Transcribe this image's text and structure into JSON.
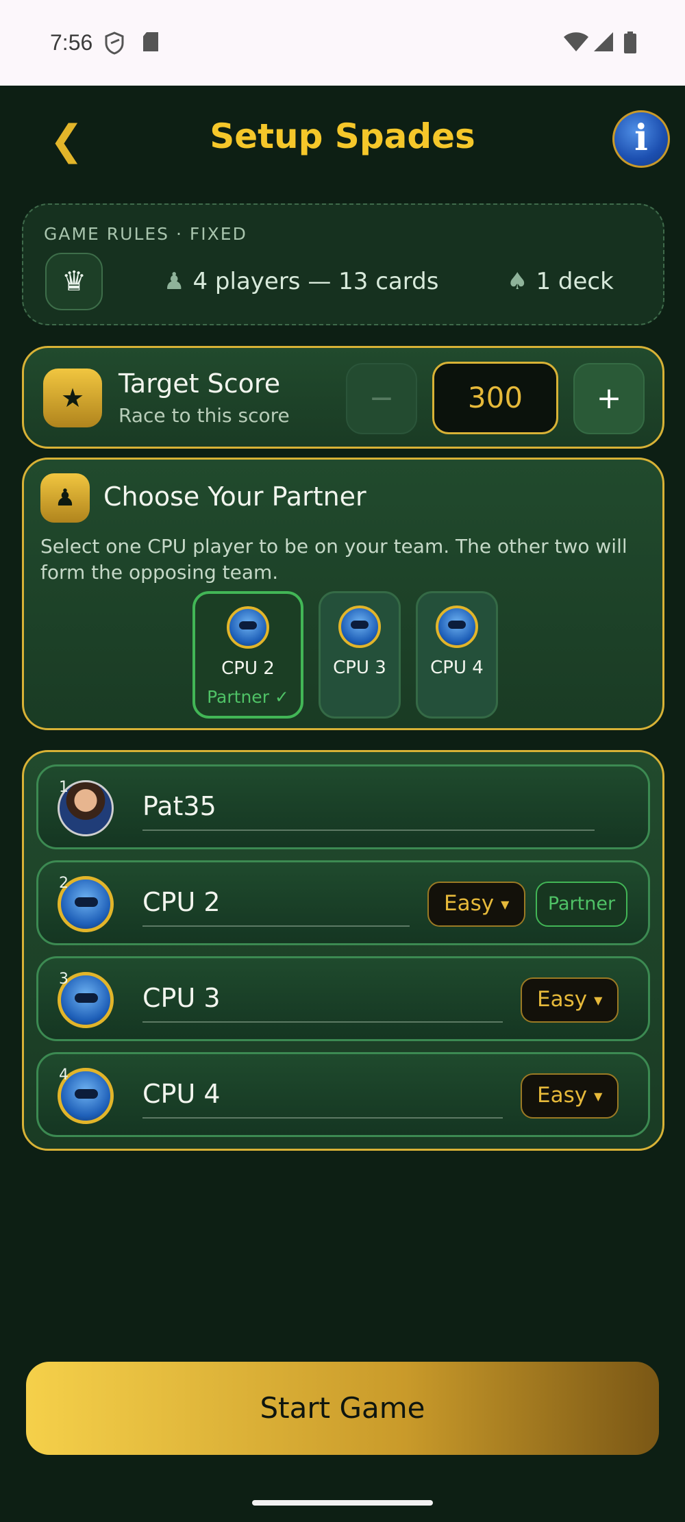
{
  "status_bar": {
    "time": "7:56"
  },
  "header": {
    "title": "Setup Spades",
    "back_glyph": "❮",
    "info_glyph": "i"
  },
  "rules": {
    "title": "GAME RULES · FIXED",
    "players": "4 players — 13 cards",
    "deck": "1 deck"
  },
  "target": {
    "title": "Target Score",
    "subtitle": "Race to this score",
    "value": "300",
    "minus": "−",
    "plus": "+"
  },
  "partner": {
    "title": "Choose Your Partner",
    "description": "Select one CPU player to be on your team. The other two will form the opposing team.",
    "options": [
      {
        "name": "CPU 2",
        "tag": "Partner ✓",
        "selected": true
      },
      {
        "name": "CPU 3",
        "selected": false
      },
      {
        "name": "CPU 4",
        "selected": false
      }
    ]
  },
  "players": [
    {
      "num": "1",
      "name": "Pat35",
      "type": "human"
    },
    {
      "num": "2",
      "name": "CPU 2",
      "difficulty": "Easy",
      "tag": "Partner",
      "type": "cpu"
    },
    {
      "num": "3",
      "name": "CPU 3",
      "difficulty": "Easy",
      "type": "cpu"
    },
    {
      "num": "4",
      "name": "CPU 4",
      "difficulty": "Easy",
      "type": "cpu"
    }
  ],
  "start_button": "Start Game",
  "colors": {
    "accent": "#f5c72a",
    "partner_green": "#4fc266",
    "background": "#0d1f14"
  }
}
